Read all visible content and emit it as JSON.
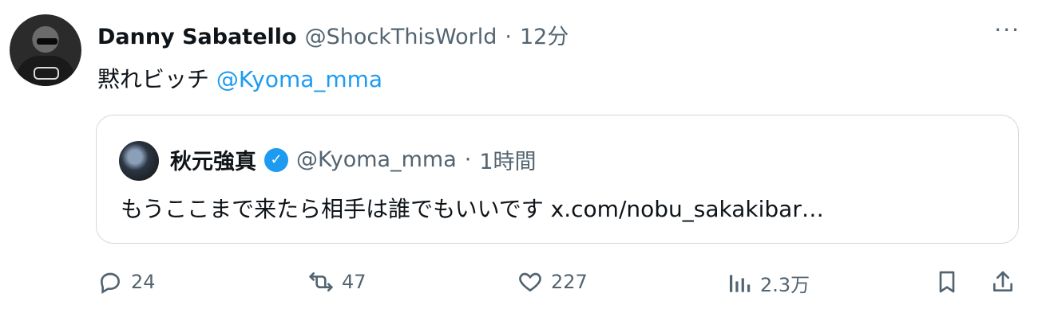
{
  "tweet": {
    "author_name": "Danny Sabatello",
    "author_handle": "@ShockThisWorld",
    "separator": "·",
    "time": "12分",
    "text": "黙れビッチ",
    "mention": "@Kyoma_mma"
  },
  "quote": {
    "author_name": "秋元強真",
    "author_handle": "@Kyoma_mma",
    "separator": "·",
    "time": "1時間",
    "text": "もうここまで来たら相手は誰でもいいです",
    "link": "x.com/nobu_sakakibar…"
  },
  "actions": {
    "reply_count": "24",
    "retweet_count": "47",
    "like_count": "227",
    "views_count": "2.3万"
  },
  "icons": {
    "more": "more-icon",
    "verified": "verified-badge-icon",
    "reply": "reply-icon",
    "retweet": "retweet-icon",
    "like": "like-icon",
    "views": "views-icon",
    "bookmark": "bookmark-icon",
    "share": "share-icon"
  },
  "colors": {
    "accent": "#1d9bf0",
    "muted": "#536471",
    "text": "#0f1419",
    "border": "#cfd9de"
  }
}
